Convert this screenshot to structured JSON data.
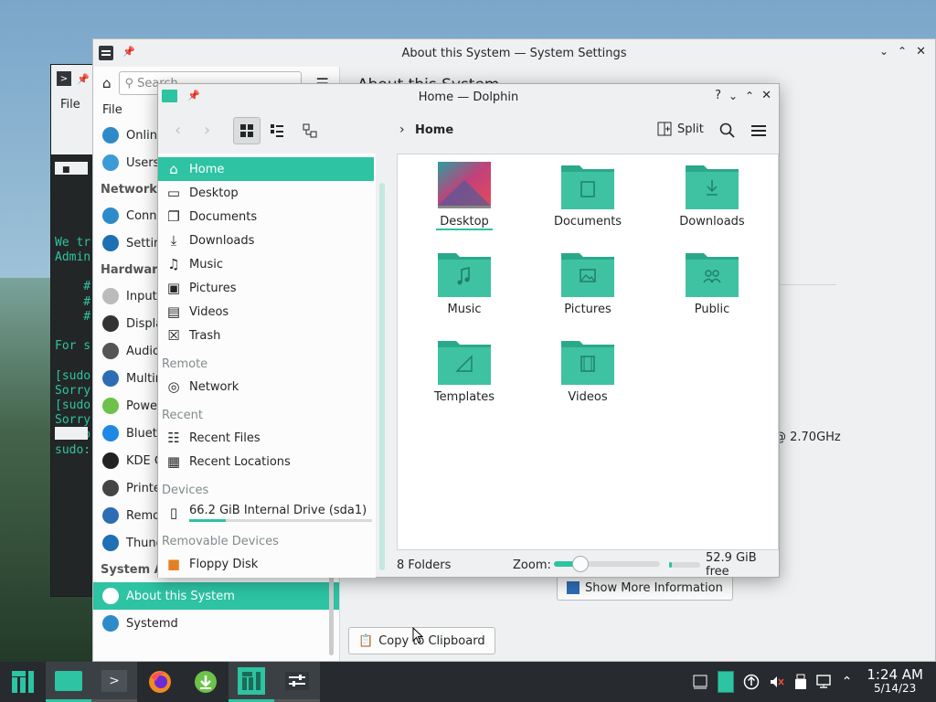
{
  "terminal": {
    "menu_file": "File",
    "tab_icon": "■",
    "lines": [
      "",
      "",
      "",
      "",
      "We tr",
      "Admin",
      "",
      "    #",
      "    #",
      "    #",
      "",
      "For s",
      "",
      "[sudo",
      "Sorry",
      "[sudo",
      "Sorry",
      "[sudo",
      "sudo:"
    ]
  },
  "system_settings": {
    "title": "About this System — System Settings",
    "search_placeholder": "Search...",
    "main_title": "About this System",
    "sidebar": {
      "file_label": "File",
      "items": [
        {
          "label": "Online Accounts",
          "icon": "online-accounts-icon"
        },
        {
          "label": "Users",
          "icon": "users-icon"
        }
      ],
      "cat_network": "Network",
      "network_items": [
        {
          "label": "Connections"
        },
        {
          "label": "Settings"
        }
      ],
      "cat_hardware": "Hardware",
      "hardware_items": [
        {
          "label": "Input Devices"
        },
        {
          "label": "Display and Monitor"
        },
        {
          "label": "Audio"
        },
        {
          "label": "Multimedia"
        },
        {
          "label": "Power Management"
        },
        {
          "label": "Bluetooth"
        },
        {
          "label": "KDE Connect"
        },
        {
          "label": "Printers"
        },
        {
          "label": "Removable Storage"
        },
        {
          "label": "Thunderbolt"
        }
      ],
      "cat_sysadmin": "System Administration",
      "sysadmin_items": [
        {
          "label": "About this System",
          "selected": true
        },
        {
          "label": "Systemd"
        }
      ]
    },
    "cpu_suffix": "@ 2.70GHz",
    "show_more": "Show More Information",
    "copy_clipboard": "Copy to Clipboard"
  },
  "dolphin": {
    "title": "Home — Dolphin",
    "breadcrumb": "Home",
    "split_label": "Split",
    "places": [
      {
        "label": "Home",
        "icon": "home-icon",
        "selected": true
      },
      {
        "label": "Desktop",
        "icon": "desktop-icon"
      },
      {
        "label": "Documents",
        "icon": "documents-icon"
      },
      {
        "label": "Downloads",
        "icon": "downloads-icon"
      },
      {
        "label": "Music",
        "icon": "music-icon"
      },
      {
        "label": "Pictures",
        "icon": "pictures-icon"
      },
      {
        "label": "Videos",
        "icon": "videos-icon"
      },
      {
        "label": "Trash",
        "icon": "trash-icon"
      }
    ],
    "heading_remote": "Remote",
    "remote": [
      {
        "label": "Network",
        "icon": "network-icon"
      }
    ],
    "heading_recent": "Recent",
    "recent": [
      {
        "label": "Recent Files",
        "icon": "recent-files-icon"
      },
      {
        "label": "Recent Locations",
        "icon": "recent-locations-icon"
      }
    ],
    "heading_devices": "Devices",
    "devices": [
      {
        "label": "66.2 GiB Internal Drive (sda1)",
        "icon": "drive-icon",
        "usage": 0.2
      }
    ],
    "heading_removable": "Removable Devices",
    "removable": [
      {
        "label": "Floppy Disk",
        "icon": "floppy-icon"
      }
    ],
    "files": [
      {
        "label": "Desktop",
        "kind": "desktop"
      },
      {
        "label": "Documents",
        "kind": "documents"
      },
      {
        "label": "Downloads",
        "kind": "downloads"
      },
      {
        "label": "Music",
        "kind": "music"
      },
      {
        "label": "Pictures",
        "kind": "pictures"
      },
      {
        "label": "Public",
        "kind": "public"
      },
      {
        "label": "Templates",
        "kind": "templates"
      },
      {
        "label": "Videos",
        "kind": "videos"
      }
    ],
    "status_count": "8 Folders",
    "zoom_label": "Zoom:",
    "zoom_level": 0.25,
    "free_space": "52.9 GiB free",
    "free_usage": 0.08
  },
  "taskbar": {
    "time": "1:24 AM",
    "date": "5/14/23"
  },
  "colors": {
    "accent": "#2dc3a3",
    "folder": "#3fc2a2",
    "folder_dark": "#2aa98a",
    "panel": "#272a2e"
  }
}
